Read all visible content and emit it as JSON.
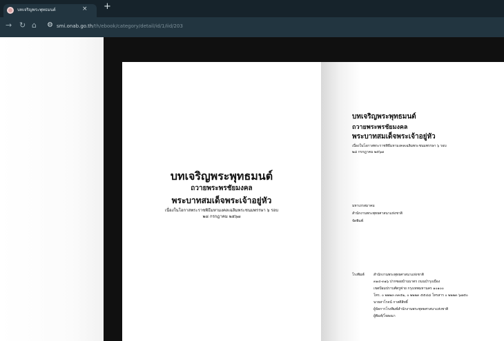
{
  "browser": {
    "tab_title": "บทเจริญพระพุทธมนต์",
    "close_symbol": "×",
    "new_tab_symbol": "+",
    "url_host": "smi.onab.go.th",
    "url_path": "/th/ebook/category/detail/id/1/iid/203"
  },
  "book": {
    "left_page": {
      "title": "บทเจริญพระพุทธมนต์",
      "subtitle": "ถวายพระพรชัยมงคล",
      "subtitle2": "พระบาทสมเด็จพระเจ้าอยู่หัว",
      "line1": "เนื่องในโอกาสพระราชพิธีมหามงคลเฉลิมพระชนมพรรษา ๖ รอบ",
      "line2": "๒๘ กรกฎาคม ๒๕๖๗"
    },
    "right_page": {
      "title": "บทเจริญพระพุทธมนต์",
      "subtitle": "ถวายพระพรชัยมงคล",
      "subtitle2": "พระบาทสมเด็จพระเจ้าอยู่หัว",
      "line1": "เนื่องในโอกาสพระราชพิธีมหามงคลเฉลิมพระชนมพรรษา ๖ รอบ",
      "line2": "๒๘ กรกฎาคม ๒๕๖๗",
      "org1": "มหาเถรสมาคม",
      "org2": "สำนักงานพระพุทธศาสนาแห่งชาติ",
      "org3": "จัดพิมพ์",
      "print_label": "โรงพิมพ์",
      "print_lines": [
        "สำนักงานพระพุทธศาสนาแห่งชาติ",
        "๓๑๔-๓๑๖ ปากซอยบ้านบาตร ถนนบำรุงเมือง",
        "เขตป้อมปราบศัตรูพ่าย กรุงเทพมหานคร ๑๐๑๐๐",
        "โทร. ๐ ๒๒๒๓ ๓๓๕๑, ๐ ๒๒๒๓ ๕๕๔๘ โทรสาร ๐ ๒๒๒๓ ๖๗๕๐",
        "นายสาโรจน์ กาสติสิทธิ์",
        "ผู้จัดการโรงพิมพ์สำนักงานพระพุทธศาสนาแห่งชาติ",
        "ผู้พิมพ์/โฆษณา"
      ]
    }
  }
}
